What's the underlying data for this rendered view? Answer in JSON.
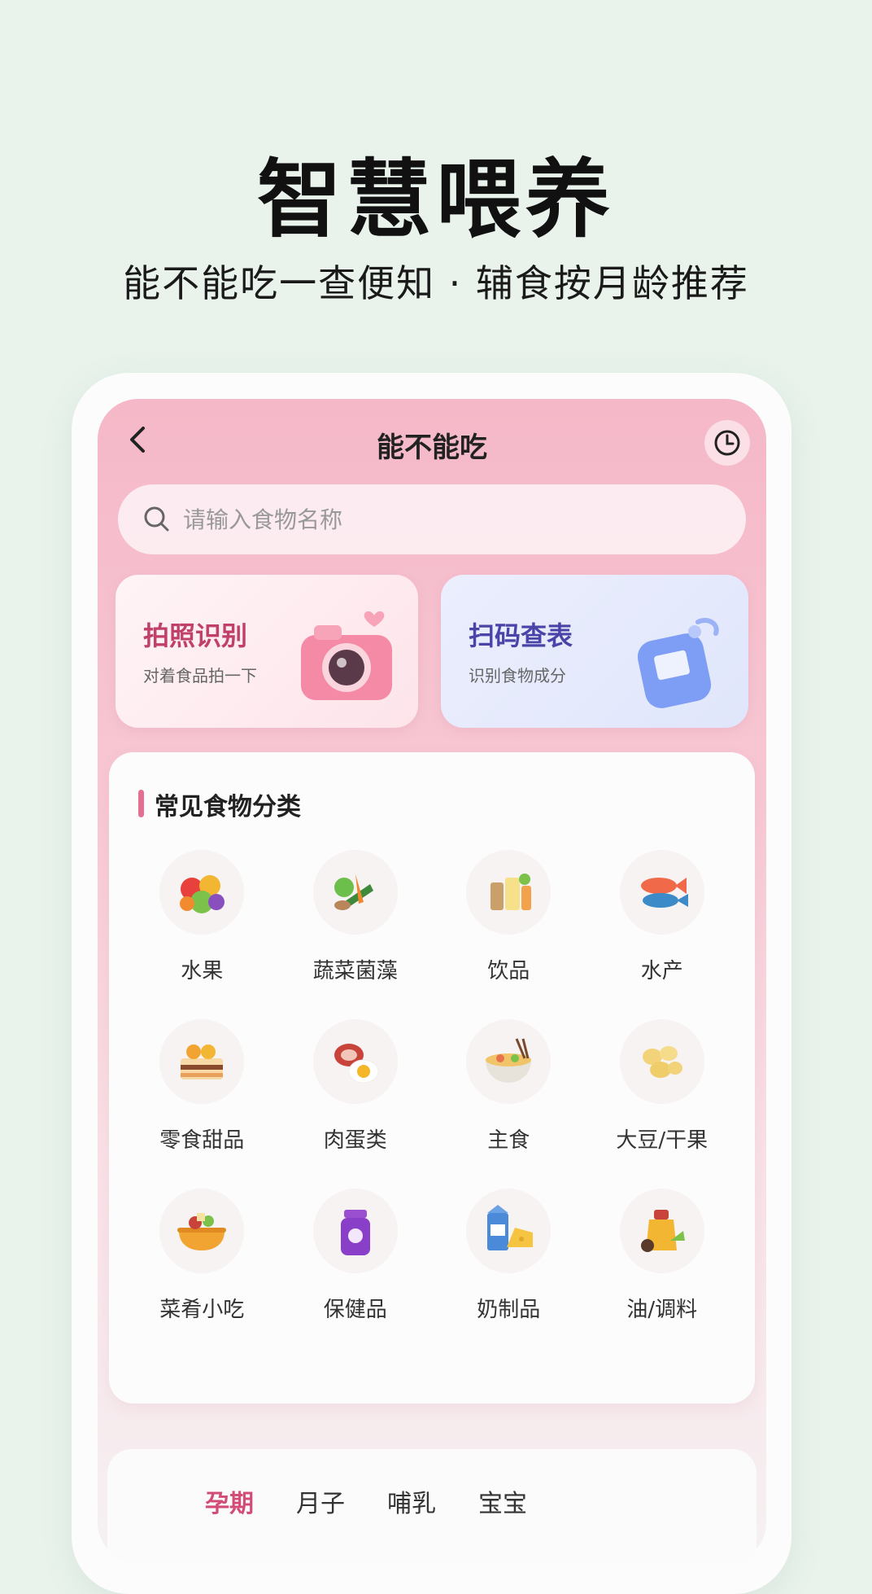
{
  "promo": {
    "headline": "智慧喂养",
    "subheadline": "能不能吃一查便知 · 辅食按月龄推荐"
  },
  "navbar": {
    "title": "能不能吃",
    "back_icon": "chevron-left-icon",
    "history_icon": "clock-icon"
  },
  "search": {
    "placeholder": "请输入食物名称",
    "icon": "search-icon"
  },
  "feature_cards": [
    {
      "title": "拍照识别",
      "subtitle": "对着食品拍一下",
      "icon": "camera-icon"
    },
    {
      "title": "扫码查表",
      "subtitle": "识别食物成分",
      "icon": "scanner-icon"
    }
  ],
  "categories_panel": {
    "title": "常见食物分类",
    "items": [
      {
        "label": "水果",
        "icon": "fruit-icon"
      },
      {
        "label": "蔬菜菌藻",
        "icon": "vegetable-icon"
      },
      {
        "label": "饮品",
        "icon": "drink-icon"
      },
      {
        "label": "水产",
        "icon": "fish-icon"
      },
      {
        "label": "零食甜品",
        "icon": "cake-icon"
      },
      {
        "label": "肉蛋类",
        "icon": "meat-egg-icon"
      },
      {
        "label": "主食",
        "icon": "noodle-bowl-icon"
      },
      {
        "label": "大豆/干果",
        "icon": "nuts-icon"
      },
      {
        "label": "菜肴小吃",
        "icon": "hotpot-icon"
      },
      {
        "label": "保健品",
        "icon": "supplement-icon"
      },
      {
        "label": "奶制品",
        "icon": "milk-cheese-icon"
      },
      {
        "label": "油/调料",
        "icon": "seasoning-icon"
      }
    ]
  },
  "stage_tabs": {
    "items": [
      "孕期",
      "月子",
      "哺乳",
      "宝宝"
    ],
    "active": "孕期"
  },
  "colors": {
    "background": "#e9f3ec",
    "accent": "#d14d77",
    "header_pink": "#f5b8c8",
    "scan_purple": "#4b44a8"
  }
}
